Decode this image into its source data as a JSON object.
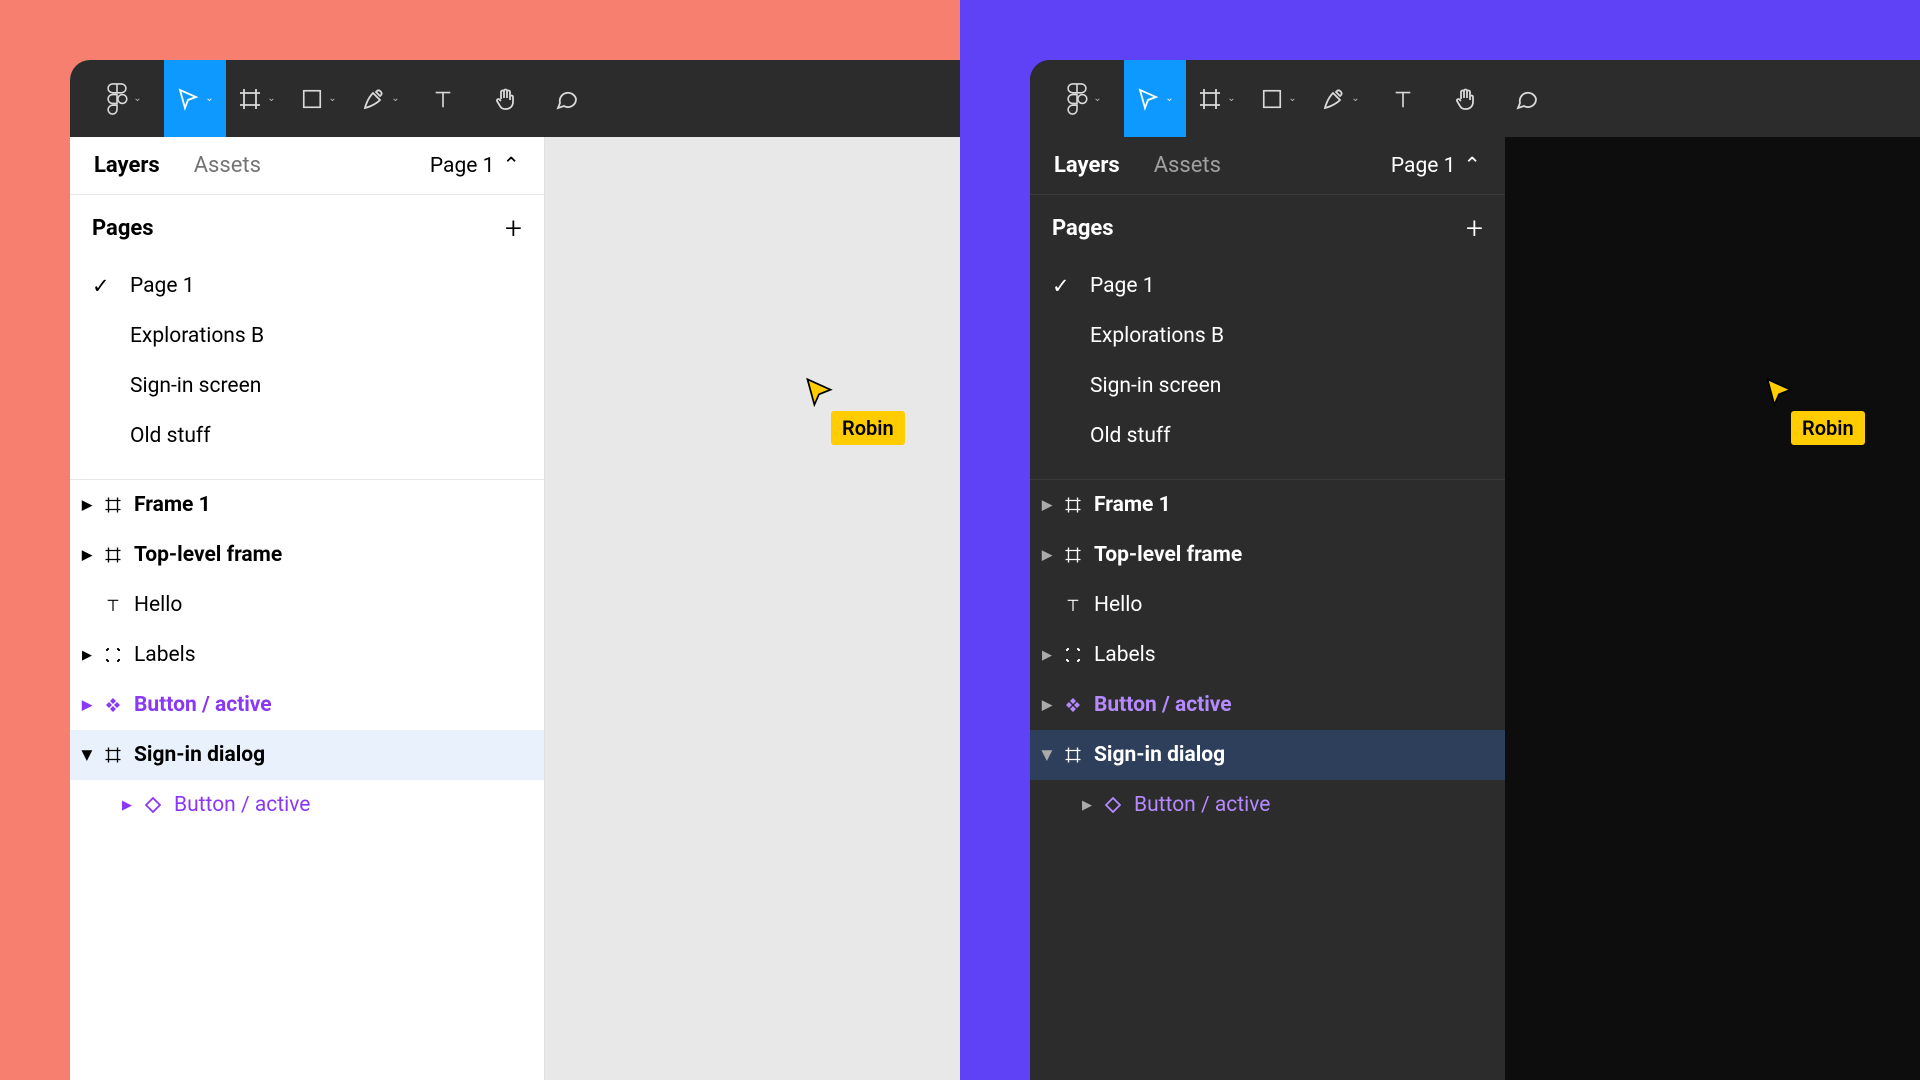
{
  "colors": {
    "light_bg": "#F77F6F",
    "dark_bg": "#5F42F5",
    "toolbar": "#2C2C2C",
    "active_tool": "#0D99FF",
    "purple": "#8A38F5",
    "cursor_badge": "#FFCC00"
  },
  "tabs": {
    "active": "Layers",
    "inactive": "Assets"
  },
  "page_selector": "Page 1",
  "pages_header": "Pages",
  "pages": [
    {
      "name": "Page 1",
      "checked": true
    },
    {
      "name": "Explorations B",
      "checked": false
    },
    {
      "name": "Sign-in screen",
      "checked": false
    },
    {
      "name": "Old stuff",
      "checked": false
    }
  ],
  "layers": [
    {
      "name": "Frame 1",
      "icon": "frame",
      "bold": true,
      "triangle": "right"
    },
    {
      "name": "Top-level frame",
      "icon": "frame",
      "bold": true,
      "triangle": "right"
    },
    {
      "name": "Hello",
      "icon": "text",
      "bold": false,
      "triangle": "none"
    },
    {
      "name": "Labels",
      "icon": "group",
      "bold": false,
      "triangle": "right"
    },
    {
      "name": "Button / active",
      "icon": "component",
      "bold": true,
      "triangle": "right",
      "purple": true
    },
    {
      "name": "Sign-in dialog",
      "icon": "frame",
      "bold": true,
      "triangle": "down",
      "selected": true
    },
    {
      "name": "Button / active",
      "icon": "instance",
      "bold": false,
      "triangle": "right",
      "purple": true,
      "indent": 1
    }
  ],
  "cursor_user": "Robin"
}
